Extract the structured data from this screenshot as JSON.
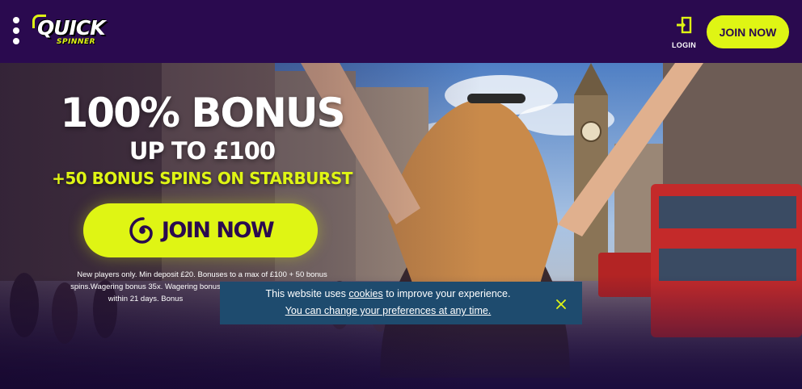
{
  "header": {
    "logo": {
      "word": "QUICK",
      "sub": "SPINNER"
    },
    "login_label": "LOGIN",
    "join_label": "JOIN NOW"
  },
  "hero": {
    "headline": "100% BONUS",
    "subheadline": "UP TO £100",
    "offer": "+50 BONUS SPINS ON STARBURST",
    "cta_label": "JOIN NOW",
    "terms_line1": "New players only. Min deposit £20. Bonuses to a max of £100 + 50 bonus",
    "terms_line2": "spins.Wagering bonus 35x. Wagering bonus spin",
    "terms_line3": "within 21 days. Bonus"
  },
  "cookie_banner": {
    "text_before": "This website uses ",
    "link_cookies": "cookies",
    "text_after": " to improve your experience.",
    "link_preferences": "You can change your preferences at any time."
  },
  "colors": {
    "header_bg": "#2a0a4f",
    "accent": "#dff514",
    "cookie_bg": "#1e4b6e"
  },
  "icons": [
    "menu-icon",
    "login-icon",
    "spiral-icon",
    "close-icon"
  ]
}
